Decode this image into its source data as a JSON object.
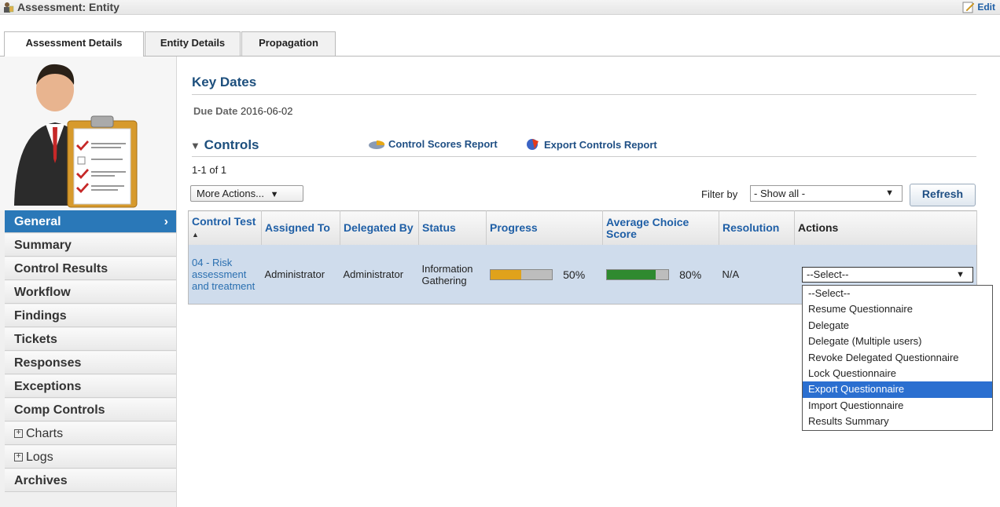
{
  "header": {
    "title": "Assessment: Entity",
    "edit_label": "Edit"
  },
  "tabs": [
    {
      "label": "Assessment Details",
      "active": true
    },
    {
      "label": "Entity Details",
      "active": false
    },
    {
      "label": "Propagation",
      "active": false
    }
  ],
  "sidebar": {
    "items": [
      {
        "label": "General",
        "active": true,
        "expandable": false
      },
      {
        "label": "Summary"
      },
      {
        "label": "Control Results"
      },
      {
        "label": "Workflow"
      },
      {
        "label": "Findings"
      },
      {
        "label": "Tickets"
      },
      {
        "label": "Responses"
      },
      {
        "label": "Exceptions"
      },
      {
        "label": "Comp Controls"
      },
      {
        "label": "Charts",
        "expandable": true
      },
      {
        "label": "Logs",
        "expandable": true
      },
      {
        "label": "Archives"
      }
    ],
    "general_chevron": "›"
  },
  "key_dates": {
    "title": "Key Dates",
    "due_label": "Due Date",
    "due_value": "2016-06-02"
  },
  "controls": {
    "title": "Controls",
    "collapse_glyph": "▼",
    "reports": [
      "Control Scores Report",
      "Export Controls Report"
    ],
    "count": "1-1 of 1",
    "more_actions": "More Actions...",
    "filter_label": "Filter by",
    "filter_value": "- Show all -",
    "refresh": "Refresh",
    "columns": [
      "Control Test",
      "Assigned To",
      "Delegated By",
      "Status",
      "Progress",
      "Average Choice Score",
      "Resolution",
      "Actions"
    ],
    "rows": [
      {
        "control_test": "04 - Risk assessment and treatment",
        "assigned_to": "Administrator",
        "delegated_by": "Administrator",
        "status": "Information Gathering",
        "progress": "50%",
        "progress_value": 0.5,
        "score": "80%",
        "score_value": 0.8,
        "resolution": "N/A"
      }
    ]
  },
  "actions_select": {
    "value": "--Select--",
    "options": [
      "--Select--",
      "Resume Questionnaire",
      "Delegate",
      "Delegate (Multiple users)",
      "Revoke Delegated Questionnaire",
      "Lock Questionnaire",
      "Export Questionnaire",
      "Import Questionnaire",
      "Results Summary"
    ],
    "highlighted": "Export Questionnaire"
  },
  "colors": {
    "accent": "#2a78b8",
    "progress": "#e0a21b",
    "score": "#2f8a2f",
    "row_bg": "#cfdcec",
    "highlight": "#2b6fd0"
  }
}
